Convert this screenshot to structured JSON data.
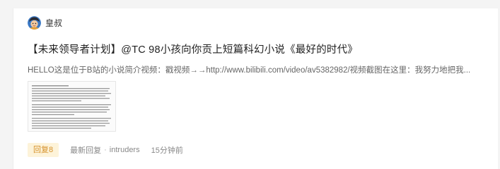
{
  "author": {
    "name": "皇叔",
    "avatar_icon": "cartoon-avatar-icon"
  },
  "post": {
    "title": "【未来领导者计划】@TC 98小孩向你贡上短篇科幻小说《最好的时代》",
    "summary": "HELLO这是位于B站的小说简介视频：戳视频→→http://www.bilibili.com/video/av5382982/视频截图在这里：我努力地把我...",
    "thumbnail_icon": "document-screenshot-icon"
  },
  "meta": {
    "reply_label": "回复8",
    "last_reply_label": "最新回复",
    "last_reply_user": "intruders",
    "separator": "·",
    "time": "15分钟前"
  },
  "colors": {
    "background": "#f4f4f4",
    "card": "#ffffff",
    "reply_badge_bg": "#fdf3d9",
    "reply_badge_text": "#d6912b"
  }
}
